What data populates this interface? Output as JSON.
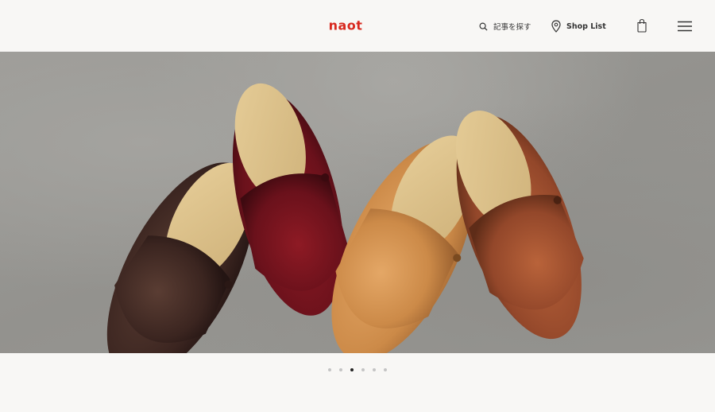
{
  "header": {
    "logo": "naot",
    "search_label": "記事を探す",
    "shop_list_label": "Shop List",
    "bag_icon": "shopping-bag-icon",
    "menu_icon": "hamburger-menu-icon"
  },
  "carousel": {
    "slide_count": 6,
    "active_index": 2,
    "image_alt": "Four leather clog shoes on concrete"
  },
  "colors": {
    "brand": "#d8291f",
    "active_dot": "#222222",
    "inactive_dot": "#c4c4c4"
  }
}
